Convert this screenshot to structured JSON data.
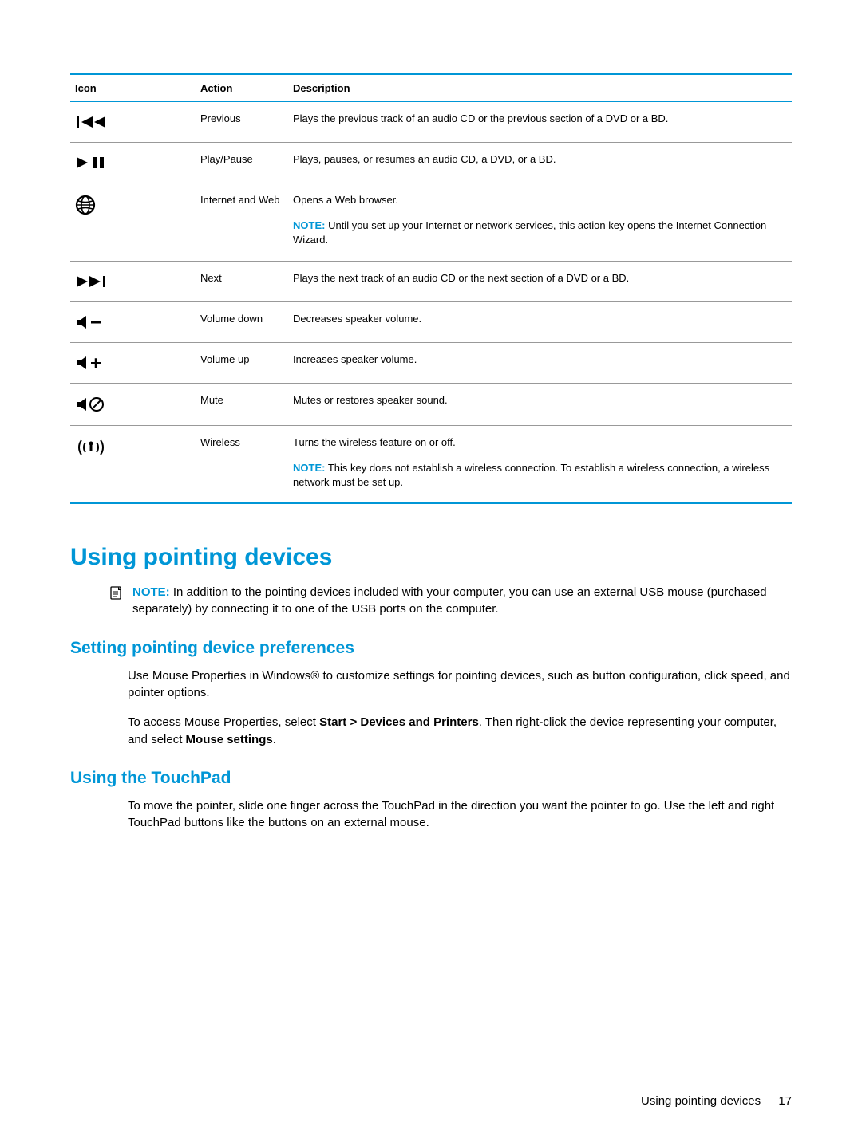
{
  "table": {
    "headers": {
      "icon": "Icon",
      "action": "Action",
      "description": "Description"
    },
    "note_label": "NOTE:",
    "rows": [
      {
        "icon": "previous-track-icon",
        "action": "Previous",
        "description": "Plays the previous track of an audio CD or the previous section of a DVD or a BD."
      },
      {
        "icon": "play-pause-icon",
        "action": "Play/Pause",
        "description": "Plays, pauses, or resumes an audio CD, a DVD, or a BD."
      },
      {
        "icon": "globe-icon",
        "action": "Internet and Web",
        "description": "Opens a Web browser.",
        "note": "Until you set up your Internet or network services, this action key opens the Internet Connection Wizard."
      },
      {
        "icon": "next-track-icon",
        "action": "Next",
        "description": "Plays the next track of an audio CD or the next section of a DVD or a BD."
      },
      {
        "icon": "volume-down-icon",
        "action": "Volume down",
        "description": "Decreases speaker volume."
      },
      {
        "icon": "volume-up-icon",
        "action": "Volume up",
        "description": "Increases speaker volume."
      },
      {
        "icon": "mute-icon",
        "action": "Mute",
        "description": "Mutes or restores speaker sound."
      },
      {
        "icon": "wireless-icon",
        "action": "Wireless",
        "description": "Turns the wireless feature on or off.",
        "note": "This key does not establish a wireless connection. To establish a wireless connection, a wireless network must be set up."
      }
    ]
  },
  "headings": {
    "h1": "Using pointing devices",
    "h2a": "Setting pointing device preferences",
    "h2b": "Using the TouchPad"
  },
  "page_note": {
    "label": "NOTE:",
    "text": "In addition to the pointing devices included with your computer, you can use an external USB mouse (purchased separately) by connecting it to one of the USB ports on the computer."
  },
  "section_a": {
    "p1_pre": "Use Mouse Properties in Windows® to customize settings for pointing devices, such as button configuration, click speed, and pointer options.",
    "p2_pre": "To access Mouse Properties, select ",
    "p2_bold1": "Start > Devices and Printers",
    "p2_mid": ". Then right-click the device representing your computer, and select ",
    "p2_bold2": "Mouse settings",
    "p2_post": "."
  },
  "section_b": {
    "p1": "To move the pointer, slide one finger across the TouchPad in the direction you want the pointer to go. Use the left and right TouchPad buttons like the buttons on an external mouse."
  },
  "footer": {
    "section": "Using pointing devices",
    "page": "17"
  }
}
